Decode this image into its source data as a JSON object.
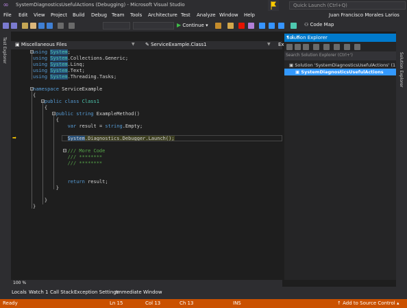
{
  "window": {
    "title": "SystemDiagnosticsUsefulActions (Debugging) - Microsoft Visual Studio",
    "quick_launch_placeholder": "Quick Launch (Ctrl+Q)",
    "user": "Juan Francisco Morales Larios"
  },
  "menu": [
    "File",
    "Edit",
    "View",
    "Project",
    "Build",
    "Debug",
    "Team",
    "Tools",
    "Architecture",
    "Test",
    "Analyze",
    "Window",
    "Help"
  ],
  "toolbar": {
    "continue_label": "Continue",
    "code_map_label": "Code Map"
  },
  "left_strip": {
    "label": "Test Explorer"
  },
  "editor": {
    "project_dropdown": "Miscellaneous Files",
    "class_dropdown": "ServiceExample.Class1",
    "member_dropdown": "Exa",
    "zoom": "100 %",
    "code_lines": [
      {
        "t": "using System;"
      },
      {
        "t": "using System.Collections.Generic;"
      },
      {
        "t": "using System.Linq;"
      },
      {
        "t": "using System.Text;"
      },
      {
        "t": "using System.Threading.Tasks;"
      },
      {
        "t": ""
      },
      {
        "t": "namespace ServiceExample"
      },
      {
        "t": "{"
      },
      {
        "t": "    public class Class1"
      },
      {
        "t": "    {"
      },
      {
        "t": "        public string ExampleMethod()"
      },
      {
        "t": "        {"
      },
      {
        "t": "            var result = string.Empty;"
      },
      {
        "t": ""
      },
      {
        "t": "            System.Diagnostics.Debugger.Launch();"
      },
      {
        "t": ""
      },
      {
        "t": "            /// More Code"
      },
      {
        "t": "            /// ********"
      },
      {
        "t": "            /// ********"
      },
      {
        "t": ""
      },
      {
        "t": ""
      },
      {
        "t": "            return result;"
      },
      {
        "t": "        }"
      },
      {
        "t": ""
      },
      {
        "t": "    }"
      },
      {
        "t": "}"
      }
    ]
  },
  "solution_explorer": {
    "title": "Solution Explorer",
    "search_placeholder": "Search Solution Explorer (Ctrl+')",
    "solution_label": "Solution 'SystemDiagnosticsUsefulActions' (1 pro",
    "project_label": "SystemDiagnosticsUsefulActions"
  },
  "right_strip": {
    "label": "Solution Explorer"
  },
  "bottom_tabs": [
    "Locals",
    "Watch 1",
    "Call Stack",
    "Exception Settings",
    "Immediate Window"
  ],
  "status": {
    "ready": "Ready",
    "ln": "Ln 15",
    "col": "Col 13",
    "ch": "Ch 13",
    "ins": "INS",
    "source_control": "Add to Source Control"
  },
  "colors": {
    "accent": "#007acc",
    "status_bar": "#ca5100",
    "background": "#1e1e1e"
  }
}
